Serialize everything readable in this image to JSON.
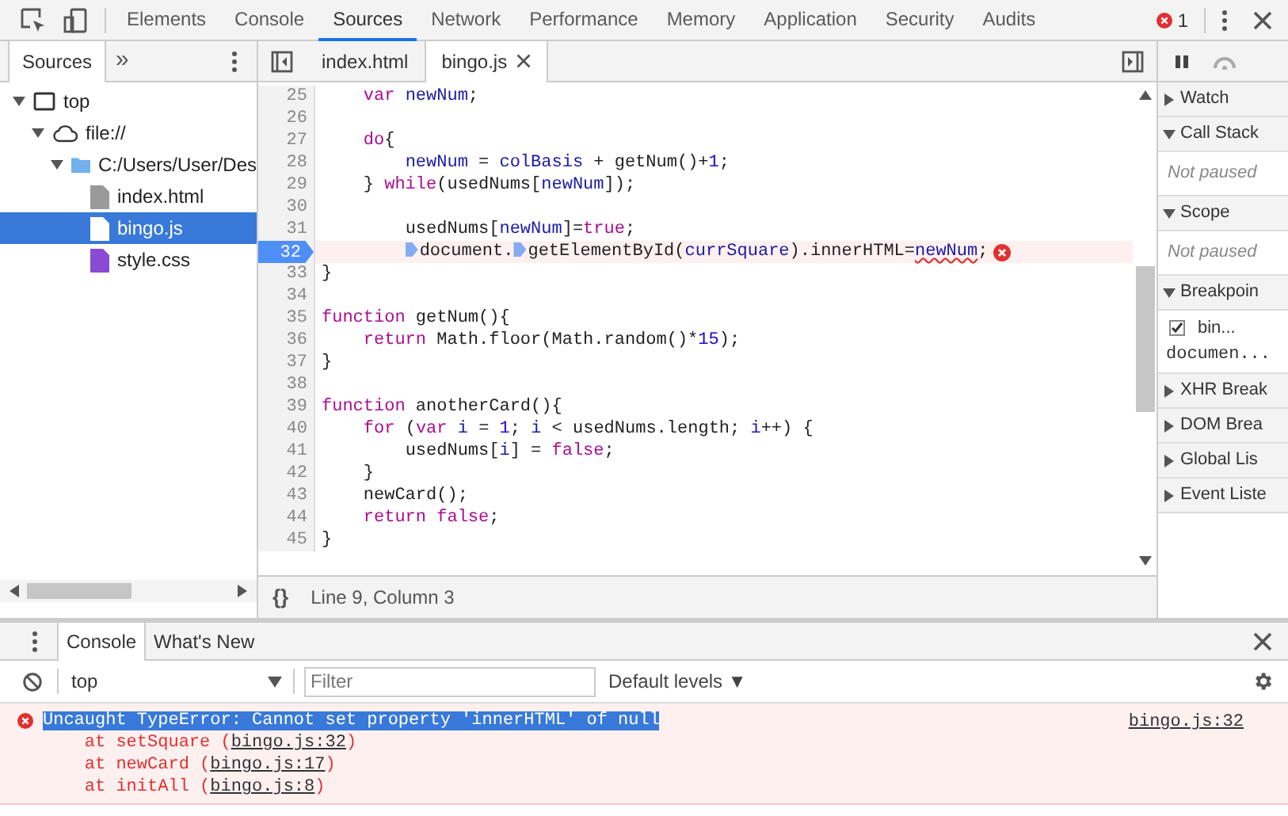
{
  "main_tabs": [
    {
      "label": "Elements",
      "selected": false
    },
    {
      "label": "Console",
      "selected": false
    },
    {
      "label": "Sources",
      "selected": true
    },
    {
      "label": "Network",
      "selected": false
    },
    {
      "label": "Performance",
      "selected": false
    },
    {
      "label": "Memory",
      "selected": false
    },
    {
      "label": "Application",
      "selected": false
    },
    {
      "label": "Security",
      "selected": false
    },
    {
      "label": "Audits",
      "selected": false
    }
  ],
  "error_count": "1",
  "navigator": {
    "tabs": [
      {
        "label": "Sources",
        "selected": true
      }
    ],
    "more": "»",
    "tree": [
      {
        "label": "top",
        "kind": "frame",
        "expanded": true,
        "selected": false,
        "children": [
          {
            "label": "file://",
            "kind": "cloud",
            "expanded": true,
            "selected": false,
            "children": [
              {
                "label": "C:/Users/User/Des",
                "kind": "folder",
                "expanded": true,
                "selected": false,
                "children": [
                  {
                    "label": "index.html",
                    "kind": "html",
                    "selected": false
                  },
                  {
                    "label": "bingo.js",
                    "kind": "js",
                    "selected": true
                  },
                  {
                    "label": "style.css",
                    "kind": "css",
                    "selected": false
                  }
                ]
              }
            ]
          }
        ]
      }
    ]
  },
  "editor": {
    "tabs": [
      {
        "label": "index.html",
        "selected": false
      },
      {
        "label": "bingo.js",
        "selected": true
      }
    ],
    "lines": [
      {
        "number": "25",
        "breakpoint": false,
        "error": false,
        "tokens": [
          {
            "text": "    var ",
            "kind": "keyword"
          },
          {
            "text": "newNum",
            "kind": "variable"
          },
          {
            "text": ";",
            "kind": "plain"
          }
        ]
      },
      {
        "number": "26",
        "breakpoint": false,
        "error": false
      },
      {
        "number": "27",
        "breakpoint": false,
        "error": false,
        "tokens": [
          {
            "text": "    do",
            "kind": "keyword"
          },
          {
            "text": "{",
            "kind": "plain"
          }
        ]
      },
      {
        "number": "28",
        "breakpoint": false,
        "error": false,
        "tokens": [
          {
            "text": "        newNum",
            "kind": "variable"
          },
          {
            "text": " = ",
            "kind": "plain"
          },
          {
            "text": "colBasis",
            "kind": "variable"
          },
          {
            "text": " + getNum()+",
            "kind": "plain"
          },
          {
            "text": "1",
            "kind": "number"
          },
          {
            "text": ";",
            "kind": "plain"
          }
        ]
      },
      {
        "number": "29",
        "breakpoint": false,
        "error": false,
        "tokens": [
          {
            "text": "    } ",
            "kind": "plain"
          },
          {
            "text": "while",
            "kind": "keyword"
          },
          {
            "text": "(usedNums[",
            "kind": "plain"
          },
          {
            "text": "newNum",
            "kind": "variable"
          },
          {
            "text": "]);",
            "kind": "plain"
          }
        ]
      },
      {
        "number": "30",
        "breakpoint": false,
        "error": false
      },
      {
        "number": "31",
        "breakpoint": false,
        "error": false,
        "tokens": [
          {
            "text": "        usedNums[",
            "kind": "plain"
          },
          {
            "text": "newNum",
            "kind": "variable"
          },
          {
            "text": "]=",
            "kind": "plain"
          },
          {
            "text": "true",
            "kind": "keyword"
          },
          {
            "text": ";",
            "kind": "plain"
          }
        ]
      },
      {
        "number": "32",
        "breakpoint": true,
        "error": true,
        "tokens": [
          {
            "text": "        document.",
            "kind": "plain",
            "marker": true
          },
          {
            "text": "getElementById(",
            "kind": "plain",
            "marker": true
          },
          {
            "text": "currSquare",
            "kind": "variable"
          },
          {
            "text": ").innerHTML=",
            "kind": "plain"
          },
          {
            "text": "newNum",
            "kind": "variable",
            "squiggle": true
          },
          {
            "text": ";",
            "kind": "plain"
          }
        ]
      },
      {
        "number": "33",
        "breakpoint": false,
        "error": false,
        "tokens": [
          {
            "text": "}",
            "kind": "plain"
          }
        ]
      },
      {
        "number": "34",
        "breakpoint": false,
        "error": false
      },
      {
        "number": "35",
        "breakpoint": false,
        "error": false,
        "tokens": [
          {
            "text": "function",
            "kind": "keyword"
          },
          {
            "text": " getNum(){",
            "kind": "plain"
          }
        ]
      },
      {
        "number": "36",
        "breakpoint": false,
        "error": false,
        "tokens": [
          {
            "text": "    return",
            "kind": "keyword"
          },
          {
            "text": " Math.floor(Math.random()*",
            "kind": "plain"
          },
          {
            "text": "15",
            "kind": "number"
          },
          {
            "text": ");",
            "kind": "plain"
          }
        ]
      },
      {
        "number": "37",
        "breakpoint": false,
        "error": false,
        "tokens": [
          {
            "text": "}",
            "kind": "plain"
          }
        ]
      },
      {
        "number": "38",
        "breakpoint": false,
        "error": false
      },
      {
        "number": "39",
        "breakpoint": false,
        "error": false,
        "tokens": [
          {
            "text": "function",
            "kind": "keyword"
          },
          {
            "text": " anotherCard(){",
            "kind": "plain"
          }
        ]
      },
      {
        "number": "40",
        "breakpoint": false,
        "error": false,
        "tokens": [
          {
            "text": "    for",
            "kind": "keyword"
          },
          {
            "text": " (",
            "kind": "plain"
          },
          {
            "text": "var ",
            "kind": "keyword"
          },
          {
            "text": "i",
            "kind": "variable"
          },
          {
            "text": " = ",
            "kind": "plain"
          },
          {
            "text": "1",
            "kind": "number"
          },
          {
            "text": "; ",
            "kind": "plain"
          },
          {
            "text": "i",
            "kind": "variable"
          },
          {
            "text": " < usedNums.length; ",
            "kind": "plain"
          },
          {
            "text": "i",
            "kind": "variable"
          },
          {
            "text": "++) {",
            "kind": "plain"
          }
        ]
      },
      {
        "number": "41",
        "breakpoint": false,
        "error": false,
        "tokens": [
          {
            "text": "        usedNums[",
            "kind": "plain"
          },
          {
            "text": "i",
            "kind": "variable"
          },
          {
            "text": "] = ",
            "kind": "plain"
          },
          {
            "text": "false",
            "kind": "keyword"
          },
          {
            "text": ";",
            "kind": "plain"
          }
        ]
      },
      {
        "number": "42",
        "breakpoint": false,
        "error": false,
        "tokens": [
          {
            "text": "    }",
            "kind": "plain"
          }
        ]
      },
      {
        "number": "43",
        "breakpoint": false,
        "error": false,
        "tokens": [
          {
            "text": "    newCard();",
            "kind": "plain"
          }
        ]
      },
      {
        "number": "44",
        "breakpoint": false,
        "error": false,
        "tokens": [
          {
            "text": "    return false",
            "kind": "keyword"
          },
          {
            "text": ";",
            "kind": "plain"
          }
        ]
      },
      {
        "number": "45",
        "breakpoint": false,
        "error": false,
        "tokens": [
          {
            "text": "}",
            "kind": "plain"
          }
        ]
      }
    ],
    "pretty_print": "{}",
    "position": "Line 9, Column 3"
  },
  "sidebar": [
    {
      "title": "Watch",
      "expanded": false
    },
    {
      "title": "Call Stack",
      "expanded": true,
      "note": "Not paused"
    },
    {
      "title": "Scope",
      "expanded": true,
      "note": "Not paused"
    },
    {
      "title": "Breakpoin",
      "expanded": true,
      "breakpoints": [
        {
          "file": "bin...",
          "code": "documen...",
          "checked": true
        }
      ]
    },
    {
      "title": "XHR Break",
      "expanded": false
    },
    {
      "title": "DOM Brea",
      "expanded": false
    },
    {
      "title": "Global Lis",
      "expanded": false
    },
    {
      "title": "Event Liste",
      "expanded": false
    }
  ],
  "drawer": {
    "tabs": [
      {
        "label": "Console",
        "selected": true
      },
      {
        "label": "What's New",
        "selected": false
      }
    ],
    "context": "top",
    "filter": {
      "placeholder": "Filter"
    },
    "levels": "Default levels",
    "levels_caret": "▼",
    "messages": [
      {
        "kind": "error",
        "text": "Uncaught TypeError: Cannot set property 'innerHTML' of null",
        "selected": true,
        "source": "bingo.js:32",
        "stack": [
          {
            "prefix": "    at setSquare (",
            "link": "bingo.js:32",
            "suffix": ")"
          },
          {
            "prefix": "    at newCard (",
            "link": "bingo.js:17",
            "suffix": ")"
          },
          {
            "prefix": "    at initAll (",
            "link": "bingo.js:8",
            "suffix": ")"
          }
        ]
      }
    ]
  }
}
